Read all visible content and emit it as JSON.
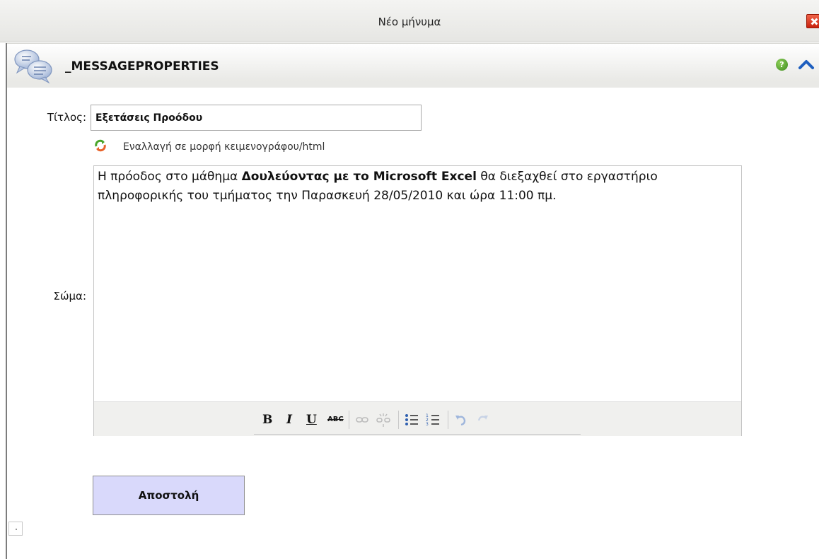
{
  "window": {
    "title": "Νέο μήνυμα",
    "close_icon": "close-icon"
  },
  "panel": {
    "title": "_MESSAGEPROPERTIES",
    "icon": "chat-bubbles-icon",
    "help_icon": "help-icon",
    "collapse_icon": "chevron-up-icon"
  },
  "form": {
    "title_label": "Τίτλος:",
    "title_value": "Εξετάσεις Προόδου",
    "toggle_link": "Εναλλαγή σε μορφή κειμενογράφου/html",
    "body_label": "Σώμα:",
    "body": {
      "text_before": "Η πρόοδος στο μάθημα ",
      "bold_text": "Δουλεύοντας με το Microsoft Excel",
      "text_after": "  θα διεξαχθεί στο εργαστήριο πληροφορικής του τμήματος την Παρασκευή 28/05/2010 και ώρα 11:00 πμ."
    },
    "send_button": "Αποστολή"
  },
  "toolbar": {
    "bold": "B",
    "italic": "I",
    "underline": "U",
    "strikethrough": "ABC",
    "icons": [
      "link-icon",
      "unlink-icon",
      "bullet-list-icon",
      "numbered-list-icon",
      "undo-icon",
      "redo-icon"
    ]
  },
  "colors": {
    "send_button_bg": "#d9d9fb",
    "close_red": "#c8210d",
    "help_green": "#3b8a1c",
    "collapse_blue": "#1f5fbf"
  }
}
